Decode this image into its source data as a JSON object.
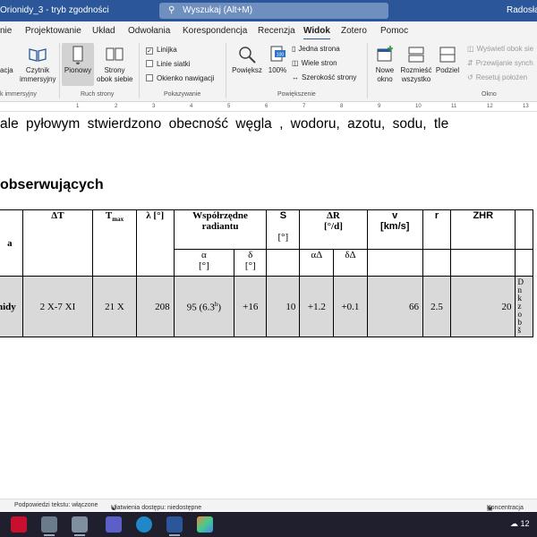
{
  "titlebar": {
    "doc_title": "Orionidy_3 - tryb zgodności",
    "search_placeholder": "Wyszukaj (Alt+M)",
    "user": "Radosław"
  },
  "tabs": [
    "nie",
    "Projektowanie",
    "Układ",
    "Odwołania",
    "Korespondencja",
    "Recenzja",
    "Widok",
    "Zotero",
    "Pomoc"
  ],
  "active_tab": "Widok",
  "ribbon": {
    "immersive_read": "acja",
    "immersive_reader_line1": "Czytnik",
    "immersive_reader_line2": "immersyjny",
    "group_immersive": "k immersyjny",
    "vertical": "Pionowy",
    "side_by_side_line1": "Strony",
    "side_by_side_line2": "obok siebie",
    "group_page_movement": "Ruch strony",
    "ruler": "Linijka",
    "gridlines": "Linie siatki",
    "nav_pane": "Okienko nawigacji",
    "group_show": "Pokazywanie",
    "zoom": "Powiększ",
    "zoom_100": "100%",
    "one_page": "Jedna strona",
    "multiple_pages": "Wiele stron",
    "page_width": "Szerokość strony",
    "group_zoom": "Powiększenie",
    "new_window_line1": "Nowe",
    "new_window_line2": "okno",
    "arrange_all_line1": "Rozmieść",
    "arrange_all_line2": "wszystko",
    "split": "Podziel",
    "view_side_by_side": "Wyświetl obok sie",
    "sync_scroll": "Przewijanie synch",
    "reset_position": "Resetuj położen",
    "group_window": "Okno",
    "icon_zoom_value": "100"
  },
  "ruler_marks": [
    "1",
    "2",
    "3",
    "4",
    "5",
    "6",
    "7",
    "8",
    "9",
    "10",
    "11",
    "12",
    "13"
  ],
  "document": {
    "body_line": "ale pyłowym stwierdzono obecność węgla , wodoru, azotu, sodu, tle",
    "heading": "obserwujących",
    "table": {
      "headers": {
        "col_name": "a",
        "dT": "ΔT",
        "tmax": "T",
        "tmax_sub": "max",
        "lambda": "λ [°]",
        "radiant_line1": "Współrzędne",
        "radiant_line2": "radiantu",
        "s": "S",
        "s_unit": "[°]",
        "dR_line1": "ΔR",
        "dR_line2": "[°/d]",
        "v_line1": "v",
        "v_line2": "[km/s]",
        "r": "r",
        "zhr": "ZHR",
        "alpha": "α",
        "alpha_unit": "[°]",
        "delta": "δ",
        "delta_unit": "[°]",
        "alpha_d": "αΔ",
        "delta_d": "δΔ"
      },
      "row": {
        "name": "nidy",
        "dT": "2 X-7 XI",
        "tmax": "21 X",
        "lambda": "208",
        "alpha": "95 (6.3",
        "alpha_sup": "h",
        "alpha_close": ")",
        "delta": "+16",
        "s": "10",
        "alpha_d": "+1.2",
        "delta_d": "+0.1",
        "v": "66",
        "r": "2.5",
        "zhr": "20",
        "note_fragments": [
          "D",
          "n",
          "k",
          "z",
          "o",
          "b",
          "š"
        ]
      }
    }
  },
  "statusbar": {
    "text_predictions": "Podpowiedzi tekstu: włączone",
    "accessibility": "Ułatwienia dostępu: niedostępne",
    "focus": "Koncentracja"
  },
  "taskbar": {
    "time_fragment": "12"
  },
  "colors": {
    "word_blue": "#2b579a",
    "ribbon_bg": "#f3f3f3",
    "table_row_bg": "#d9d9d9",
    "taskbar_bg": "#1f1f2e"
  }
}
